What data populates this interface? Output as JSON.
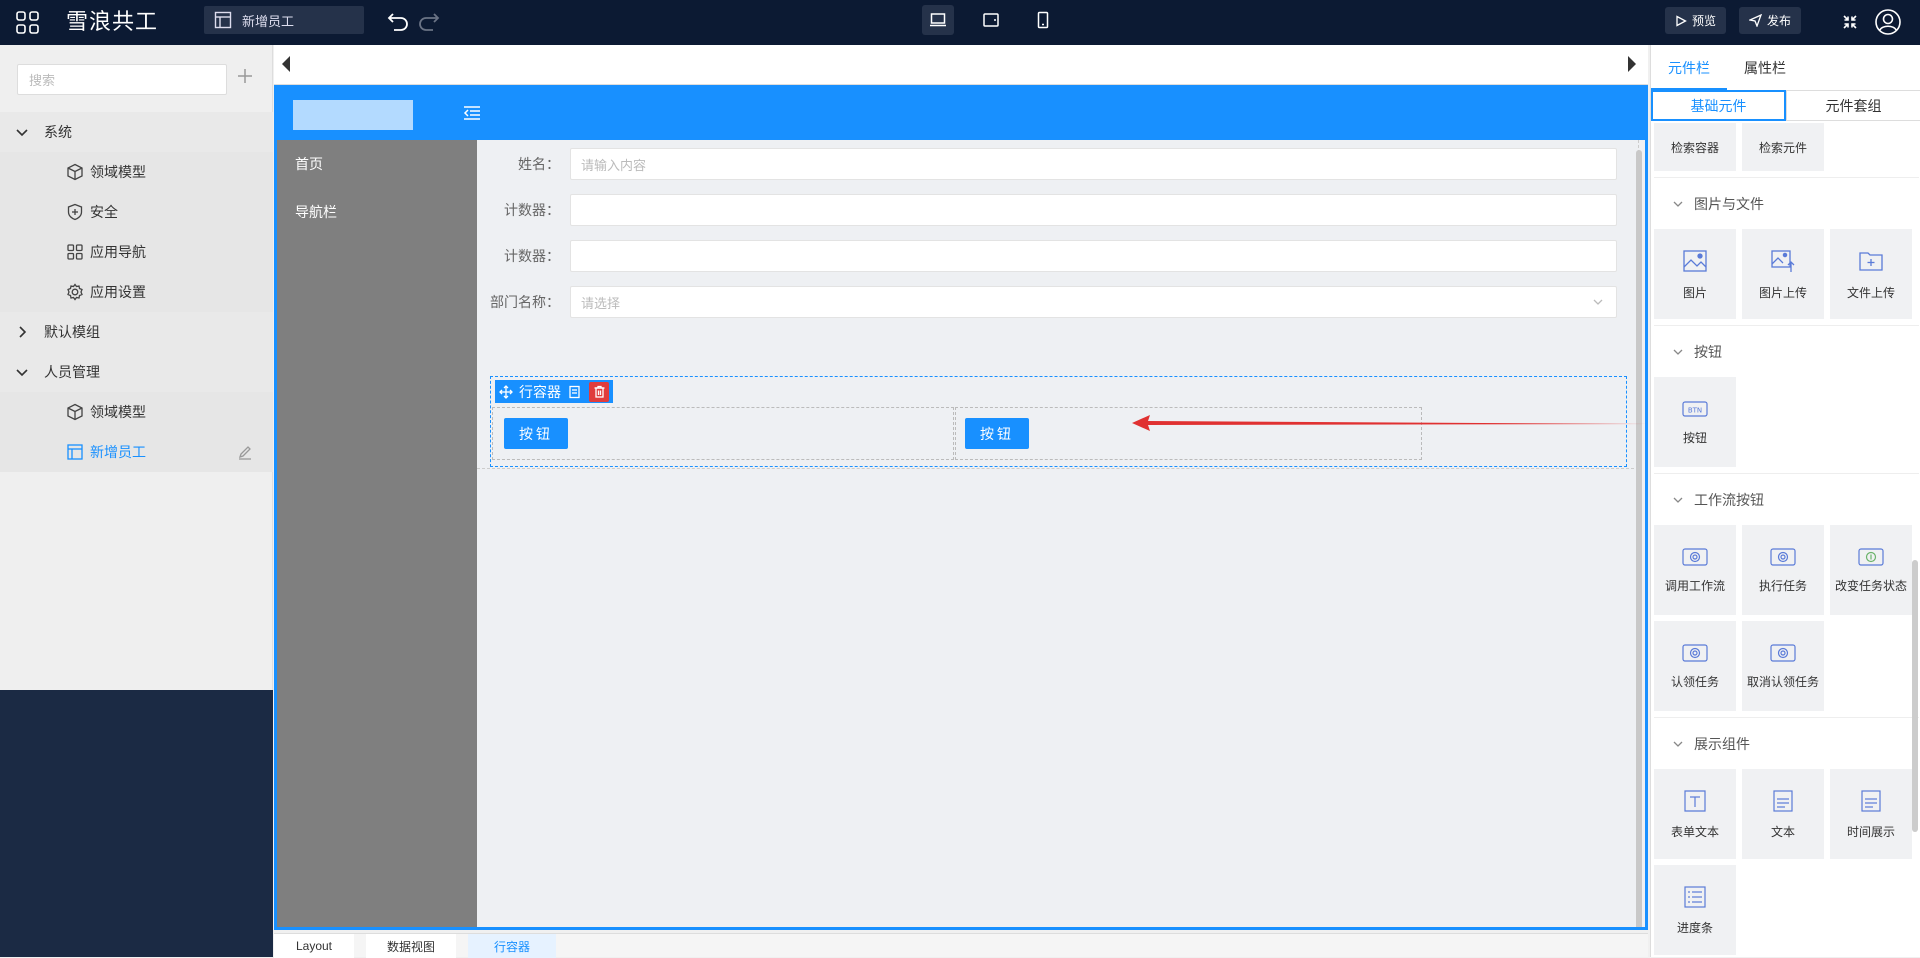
{
  "app": {
    "name": "雪浪共工",
    "page": "新增员工"
  },
  "toolbar": {
    "preview": "预览",
    "publish": "发布"
  },
  "left": {
    "search_placeholder": "搜索",
    "tree": [
      {
        "label": "系统",
        "expanded": true,
        "children": [
          "领域模型",
          "安全",
          "应用导航",
          "应用设置"
        ]
      },
      {
        "label": "默认模组",
        "expanded": false
      },
      {
        "label": "人员管理",
        "expanded": true,
        "children": [
          "领域模型",
          "新增员工"
        ]
      }
    ]
  },
  "canvas": {
    "nav": [
      "首页",
      "导航栏"
    ],
    "form": [
      {
        "label": "姓名：",
        "placeholder": "请输入内容"
      },
      {
        "label": "计数器：",
        "placeholder": ""
      },
      {
        "label": "计数器：",
        "placeholder": ""
      },
      {
        "label": "部门名称：",
        "placeholder": "请选择"
      }
    ],
    "row_container": {
      "label": "行容器",
      "buttons": [
        "按钮",
        "按钮"
      ]
    }
  },
  "breadcrumb": [
    "Layout",
    "数据视图",
    "行容器"
  ],
  "right": {
    "tabs": [
      "元件栏",
      "属性栏"
    ],
    "subtabs": [
      "基础元件",
      "元件套组"
    ],
    "top_items": [
      "检索容器",
      "检索元件"
    ],
    "sections": [
      {
        "title": "图片与文件",
        "items": [
          "图片",
          "图片上传",
          "文件上传"
        ]
      },
      {
        "title": "按钮",
        "items": [
          "按钮"
        ]
      },
      {
        "title": "工作流按钮",
        "items": [
          "调用工作流",
          "执行任务",
          "改变任务状态",
          "认领任务",
          "取消认领任务"
        ]
      },
      {
        "title": "展示组件",
        "items": [
          "表单文本",
          "文本",
          "时间展示",
          "进度条"
        ]
      }
    ]
  },
  "colors": {
    "primary": "#1890ff",
    "topbar": "#0c1a33",
    "arrow": "#e03131"
  }
}
